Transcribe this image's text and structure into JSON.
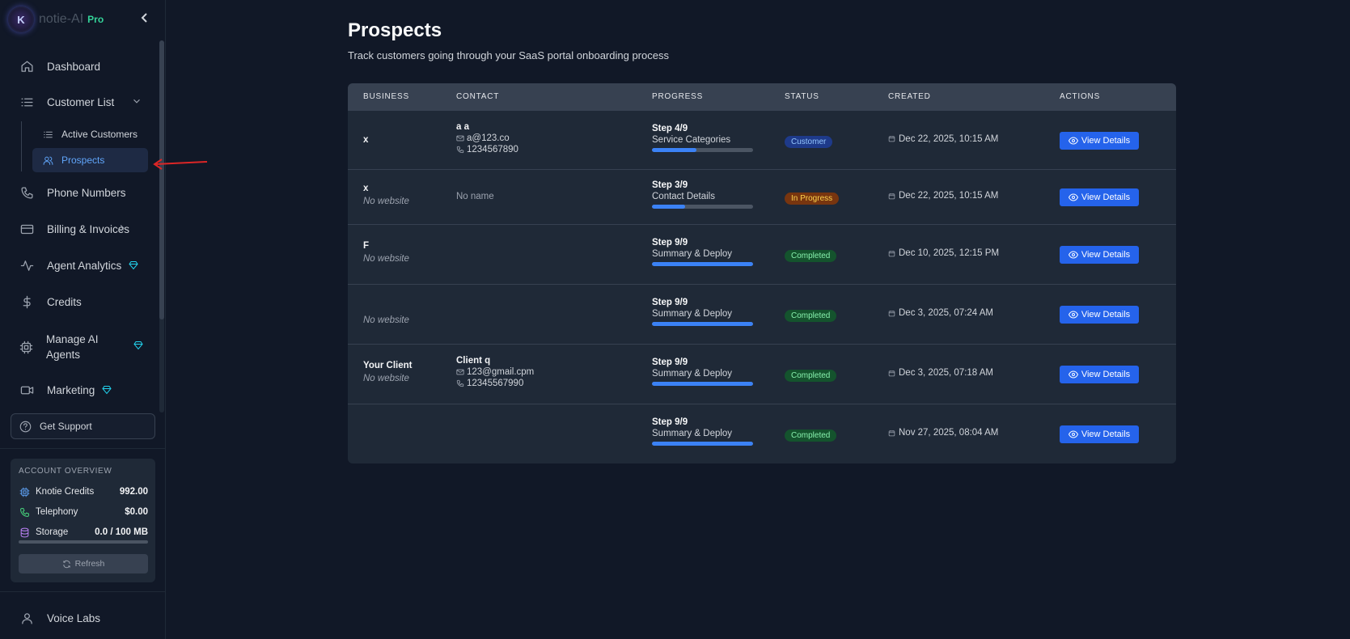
{
  "brand": {
    "logo_letter": "K",
    "name": "notie-AI",
    "tier": "Pro"
  },
  "sidebar": {
    "items": [
      {
        "label": "Dashboard",
        "icon": "home-icon"
      },
      {
        "label": "Customer List",
        "icon": "list-icon"
      },
      {
        "label": "Phone Numbers",
        "icon": "phone-icon"
      },
      {
        "label": "Billing & Invoices",
        "icon": "credit-card-icon"
      },
      {
        "label": "Agent Analytics",
        "icon": "activity-icon"
      },
      {
        "label": "Credits",
        "icon": "dollar-icon"
      },
      {
        "label": "Manage AI Agents",
        "icon": "cpu-icon"
      },
      {
        "label": "Marketing",
        "icon": "video-icon"
      }
    ],
    "sub_items": [
      {
        "label": "Active Customers",
        "icon": "list-icon"
      },
      {
        "label": "Prospects",
        "icon": "users-icon",
        "active": true
      }
    ],
    "support_label": "Get Support",
    "account": {
      "title": "ACCOUNT OVERVIEW",
      "rows": [
        {
          "label": "Knotie Credits",
          "value": "992.00"
        },
        {
          "label": "Telephony",
          "value": "$0.00"
        },
        {
          "label": "Storage",
          "value": "0.0 / 100 MB"
        }
      ],
      "storage_fraction": 0.0,
      "refresh_label": "Refresh"
    },
    "voice_labs_label": "Voice Labs"
  },
  "main": {
    "title": "Prospects",
    "subtitle": "Track customers going through your SaaS portal onboarding process",
    "columns": [
      "BUSINESS",
      "CONTACT",
      "PROGRESS",
      "STATUS",
      "CREATED",
      "ACTIONS"
    ],
    "rows": [
      {
        "business": "x",
        "website": "",
        "contact_name": "a a",
        "email": "a@123.co",
        "phone": "1234567890",
        "contact_placeholder": "",
        "step": "Step 4/9",
        "step_name": "Service Categories",
        "progress": 0.44,
        "status": "Customer",
        "created": "Dec 22, 2025, 10:15 AM",
        "action": "View Details"
      },
      {
        "business": "x",
        "website": "No website",
        "contact_name": "",
        "email": "",
        "phone": "",
        "contact_placeholder": "No name",
        "step": "Step 3/9",
        "step_name": "Contact Details",
        "progress": 0.33,
        "status": "In Progress",
        "created": "Dec 22, 2025, 10:15 AM",
        "action": "View Details"
      },
      {
        "business": "F",
        "website": "No website",
        "contact_name": "",
        "email": "",
        "phone": "",
        "contact_placeholder": "",
        "step": "Step 9/9",
        "step_name": "Summary & Deploy",
        "progress": 1.0,
        "status": "Completed",
        "created": "Dec 10, 2025, 12:15 PM",
        "action": "View Details"
      },
      {
        "business": "",
        "website": "No website",
        "contact_name": "",
        "email": "",
        "phone": "",
        "contact_placeholder": "",
        "step": "Step 9/9",
        "step_name": "Summary & Deploy",
        "progress": 1.0,
        "status": "Completed",
        "created": "Dec 3, 2025, 07:24 AM",
        "action": "View Details"
      },
      {
        "business": "Your Client",
        "website": "No website",
        "contact_name": "Client q",
        "email": "123@gmail.cpm",
        "phone": "12345567990",
        "contact_placeholder": "",
        "step": "Step 9/9",
        "step_name": "Summary & Deploy",
        "progress": 1.0,
        "status": "Completed",
        "created": "Dec 3, 2025, 07:18 AM",
        "action": "View Details"
      },
      {
        "business": "",
        "website": "",
        "contact_name": "",
        "email": "",
        "phone": "",
        "contact_placeholder": "",
        "step": "Step 9/9",
        "step_name": "Summary & Deploy",
        "progress": 1.0,
        "status": "Completed",
        "created": "Nov 27, 2025, 08:04 AM",
        "action": "View Details"
      }
    ]
  },
  "colors": {
    "accent": "#2563eb",
    "status_customer_bg": "#1e3a8a",
    "status_customer_fg": "#93c5fd",
    "status_progress_bg": "#78350f",
    "status_progress_fg": "#fcd34d",
    "status_completed_bg": "#14532d",
    "status_completed_fg": "#86efac",
    "annotation_arrow": "#dc2626"
  }
}
